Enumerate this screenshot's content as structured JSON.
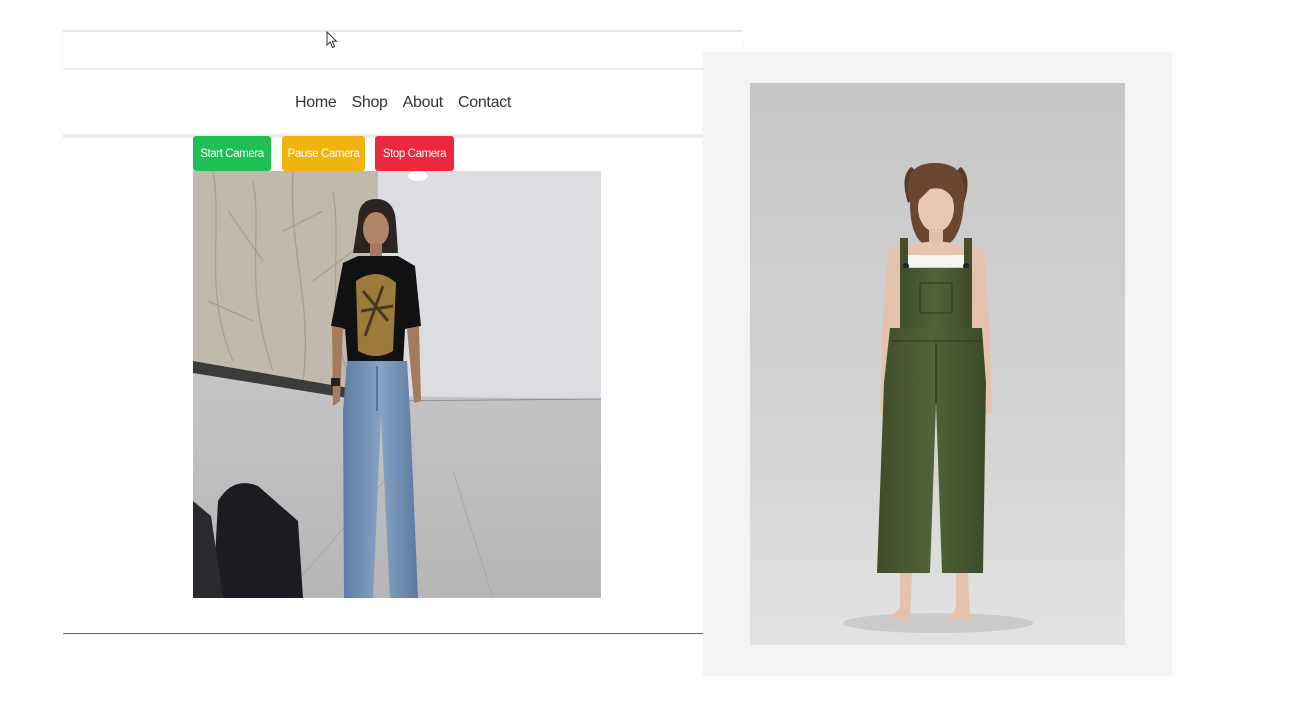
{
  "nav": {
    "links": [
      "Home",
      "Shop",
      "About",
      "Contact"
    ]
  },
  "camera_controls": {
    "start_label": "Start Camera",
    "pause_label": "Pause Camera",
    "stop_label": "Stop Camera"
  },
  "colors": {
    "start": "#1fbf53",
    "pause": "#f1b40f",
    "stop": "#ea2a3c",
    "garment": "#4a5a34"
  },
  "icons": {
    "cursor": "mouse-pointer-icon"
  }
}
